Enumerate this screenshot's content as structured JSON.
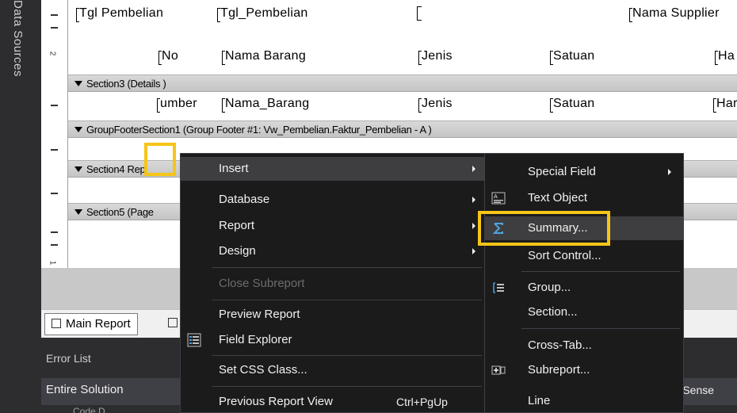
{
  "side_tab": {
    "label": "Data Sources"
  },
  "designer": {
    "header_fields": [
      "Tgl Pembelian",
      "Tgl_Pembelian",
      "Nama Supplier"
    ],
    "column_headers": [
      "No",
      "Nama Barang",
      "Jenis",
      "Satuan",
      "Ha"
    ],
    "detail_fields": [
      "umber",
      "Nama_Barang",
      "Jenis",
      "Satuan",
      "Har"
    ],
    "sections": {
      "section3": "Section3 (Details )",
      "group_footer": "GroupFooterSection1 (Group Footer #1: Vw_Pembelian.Faktur_Pembelian - A )",
      "section4": "Section4 Rep",
      "section5": "Section5 (Page"
    },
    "ruler_numbers": [
      "2",
      "1"
    ]
  },
  "report_tabs": {
    "main": "Main Report"
  },
  "error_panel": {
    "title": "Error List",
    "scope": "Entire Solution",
    "intellisense": "lliSense",
    "columns": "Code  D"
  },
  "context_menu": {
    "items": [
      {
        "label": "Insert",
        "submenu": true,
        "highlighted": true
      },
      {
        "label": "Database",
        "submenu": true
      },
      {
        "label": "Report",
        "submenu": true
      },
      {
        "label": "Design",
        "submenu": true
      },
      {
        "label": "Close Subreport",
        "disabled": true
      },
      {
        "label": "Preview Report"
      },
      {
        "label": "Field Explorer",
        "icon": "field-explorer-icon"
      },
      {
        "label": "Set CSS Class..."
      },
      {
        "label": "Previous Report View",
        "shortcut": "Ctrl+PgUp"
      }
    ]
  },
  "insert_submenu": {
    "items": [
      {
        "label": "Special Field",
        "submenu": true
      },
      {
        "label": "Text Object",
        "icon": "text-object-icon"
      },
      {
        "label": "Summary...",
        "icon": "sigma-icon",
        "highlighted": true
      },
      {
        "label": "Sort Control..."
      },
      {
        "label": "Group...",
        "icon": "group-icon"
      },
      {
        "label": "Section..."
      },
      {
        "label": "Cross-Tab..."
      },
      {
        "label": "Subreport...",
        "icon": "subreport-icon"
      },
      {
        "label": "Line"
      }
    ]
  },
  "colors": {
    "highlight": "#f5c518",
    "menu_bg": "#1b1b1c",
    "menu_hover": "#3e3e40"
  }
}
